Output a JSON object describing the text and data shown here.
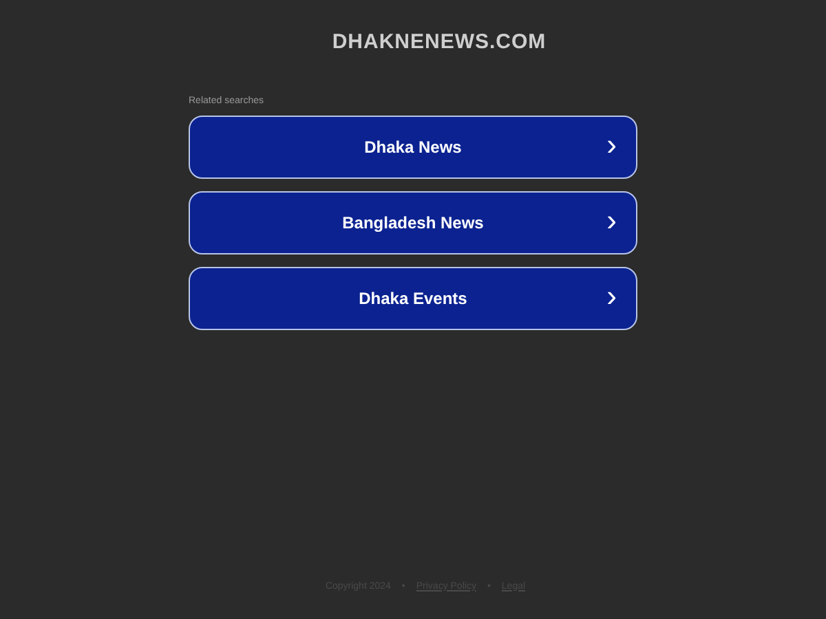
{
  "site_title": "DHAKNENEWS.COM",
  "related_label": "Related searches",
  "links": [
    {
      "label": "Dhaka News",
      "arrow": "›"
    },
    {
      "label": "Bangladesh News",
      "arrow": "›"
    },
    {
      "label": "Dhaka Events",
      "arrow": "›"
    }
  ],
  "footer": [
    {
      "kind": "text",
      "label": "Copyright 2024"
    },
    {
      "kind": "sep",
      "label": "•"
    },
    {
      "kind": "link",
      "label": "Privacy Policy"
    },
    {
      "kind": "sep",
      "label": "•"
    },
    {
      "kind": "link",
      "label": "Legal"
    }
  ]
}
